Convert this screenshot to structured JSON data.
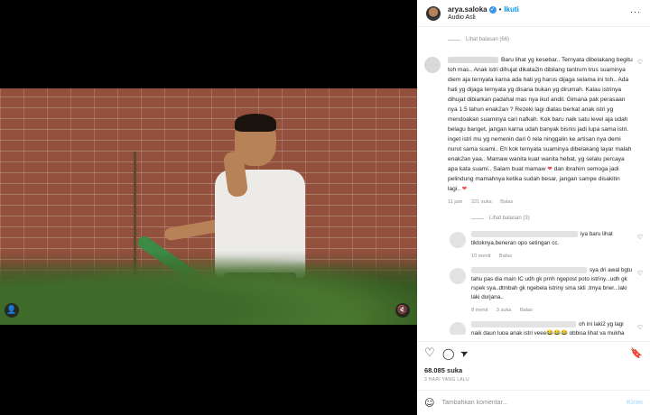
{
  "post": {
    "username": "arya.saloka",
    "follow_label": "Ikuti",
    "audio": "Audio Asli",
    "more": "···",
    "likes": "68.085 suka",
    "date": "3 HARI YANG LALU"
  },
  "comments": {
    "view_replies_top": "Lihat balasan (66)",
    "main": {
      "text_before_heart_1": "Baru lihat yg kesebar.. Ternyata dibelakang begitu toh mas.. Anak istri dihujat dikata2in dibilang tantrum trus suaminya diem aja ternyata karna ada hati yg harus dijaga selama ini toh.. Ada hati yg dijaga ternyata yg disana bukan yg dirumah. Kalau istrinya dihujat dibiarkan padahal mas nya ikut andil. Gimana pak perasaan nya 1.5 tahun enak2an ? Rezeki lagi diatas berkat anak istri yg mendoakan suaminya cari nafkah. Kok baru naik satu level aja udah belagu banget, jangan karna udah banyak bisnis jadi lupa sama istri. inget istri mu yg nemenin dari 0 rela ninggalin ke artisan nya demi nurut sama suami.. Eh kok ternyata suaminya dibelakang layar malah enak2an yaa.. Mamaw wanita kuat wanita hebat, yg selalu percaya apa kata suami.. Salam buat mamaw",
      "text_between_hearts": " dan ibrahim semoga jadi pelindung mamahnya ketika sudah besar, jangan sampe disakitin lagi..",
      "heart_glyph": "❤",
      "time": "11 jam",
      "likes": "221 suka",
      "reply_label": "Balas"
    },
    "view_replies_main": "Lihat balasan (3)",
    "replies": [
      {
        "text": "iya baru lihat tiktoknya.beneran opo setingan cc.",
        "time": "10 menit",
        "likes": "",
        "reply_label": "Balas"
      },
      {
        "text": "sya dri awal bgtu tahu pas dia main IC udh gk prnh ngepost poto istriny...udh gk rspek sya..dtmbah gk ngebela istriny sma skli .tmya bner...laki laki durjana..",
        "time": "8 menit",
        "likes": "3 suka",
        "reply_label": "Balas"
      },
      {
        "text": "oh ini laki2 yg lagi naik daun lupa anak istri yeee😂😂😂 gbbisa lihat ya mukha",
        "time": "",
        "likes": "",
        "reply_label": ""
      }
    ],
    "heart_outline": "♡"
  },
  "actions": {
    "like_icon": "♡",
    "comment_icon": "◯",
    "share_icon": "➤",
    "save_icon": "🔖"
  },
  "compose": {
    "emoji": "☺",
    "placeholder": "Tambahkan komentar...",
    "post_label": "Kirim"
  },
  "video": {
    "user_icon": "👤",
    "mute_icon": "🔇"
  }
}
